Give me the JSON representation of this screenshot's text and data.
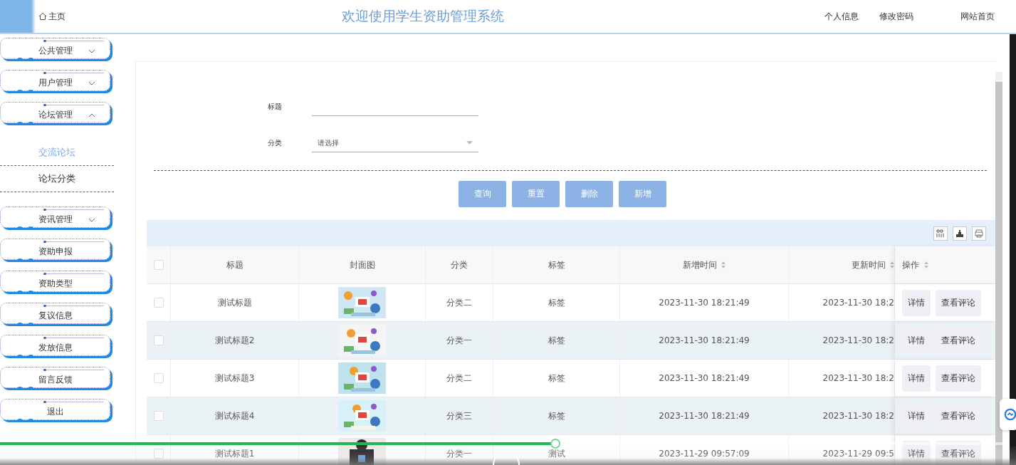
{
  "header": {
    "home_tab": "主页",
    "title": "欢迎使用学生资助管理系统",
    "links": [
      "个人信息",
      "修改密码",
      "网站首页"
    ]
  },
  "sidebar": {
    "items": [
      {
        "kind": "group",
        "label": "公共管理",
        "expanded": false
      },
      {
        "kind": "group",
        "label": "用户管理",
        "expanded": false
      },
      {
        "kind": "group",
        "label": "论坛管理",
        "expanded": true,
        "children": [
          {
            "label": "交流论坛",
            "selected": true
          },
          {
            "label": "论坛分类",
            "selected": false
          }
        ]
      },
      {
        "kind": "group",
        "label": "资讯管理",
        "expanded": false
      },
      {
        "kind": "link",
        "label": "资助申报"
      },
      {
        "kind": "link",
        "label": "资助类型"
      },
      {
        "kind": "link",
        "label": "复议信息"
      },
      {
        "kind": "link",
        "label": "发放信息"
      },
      {
        "kind": "link",
        "label": "留言反馈"
      },
      {
        "kind": "link",
        "label": "退出"
      }
    ]
  },
  "search_form": {
    "fields": [
      {
        "kind": "text",
        "label": "标题"
      },
      {
        "kind": "select",
        "label": "分类",
        "placeholder": "请选择"
      }
    ],
    "buttons": [
      "查询",
      "重置",
      "删除",
      "新增"
    ]
  },
  "table": {
    "select_all_checked": false,
    "columns": [
      {
        "label": "标题",
        "sortable": false
      },
      {
        "label": "封面图",
        "sortable": false
      },
      {
        "label": "分类",
        "sortable": false
      },
      {
        "label": "标签",
        "sortable": false
      },
      {
        "label": "新增时间",
        "sortable": true
      },
      {
        "label": "更新时间",
        "sortable": true
      },
      {
        "label": "操作",
        "sortable": true
      }
    ],
    "rows": [
      {
        "checked": false,
        "title": "测试标题",
        "cover": {
          "kind": "picture"
        },
        "category": "分类二",
        "tag": "标签",
        "created": "2023-11-30 18:21:49",
        "updated": "2023-11-30 18:2",
        "actions": [
          "详情",
          "查看评论"
        ]
      },
      {
        "checked": false,
        "title": "测试标题2",
        "cover": {
          "kind": "picture"
        },
        "category": "分类一",
        "tag": "标签",
        "created": "2023-11-30 18:21:49",
        "updated": "2023-11-30 18:2",
        "actions": [
          "详情",
          "查看评论"
        ]
      },
      {
        "checked": false,
        "title": "测试标题3",
        "cover": {
          "kind": "picture"
        },
        "category": "分类二",
        "tag": "标签",
        "created": "2023-11-30 18:21:49",
        "updated": "2023-11-30 18:2",
        "actions": [
          "详情",
          "查看评论"
        ]
      },
      {
        "checked": false,
        "title": "测试标题4",
        "cover": {
          "kind": "picture"
        },
        "category": "分类三",
        "tag": "标签",
        "created": "2023-11-30 18:21:49",
        "updated": "2023-11-30 18:2",
        "actions": [
          "详情",
          "查看评论"
        ]
      },
      {
        "checked": false,
        "title": "测试标题1",
        "cover": {
          "kind": "picture"
        },
        "category": "分类一",
        "tag": "测试",
        "created": "2023-11-29 09:57:09",
        "updated": "2023-11-29 09:5",
        "actions": [
          "详情",
          "查看评论"
        ]
      }
    ]
  },
  "video_player": {
    "progress": {
      "level": 0.55
    }
  }
}
